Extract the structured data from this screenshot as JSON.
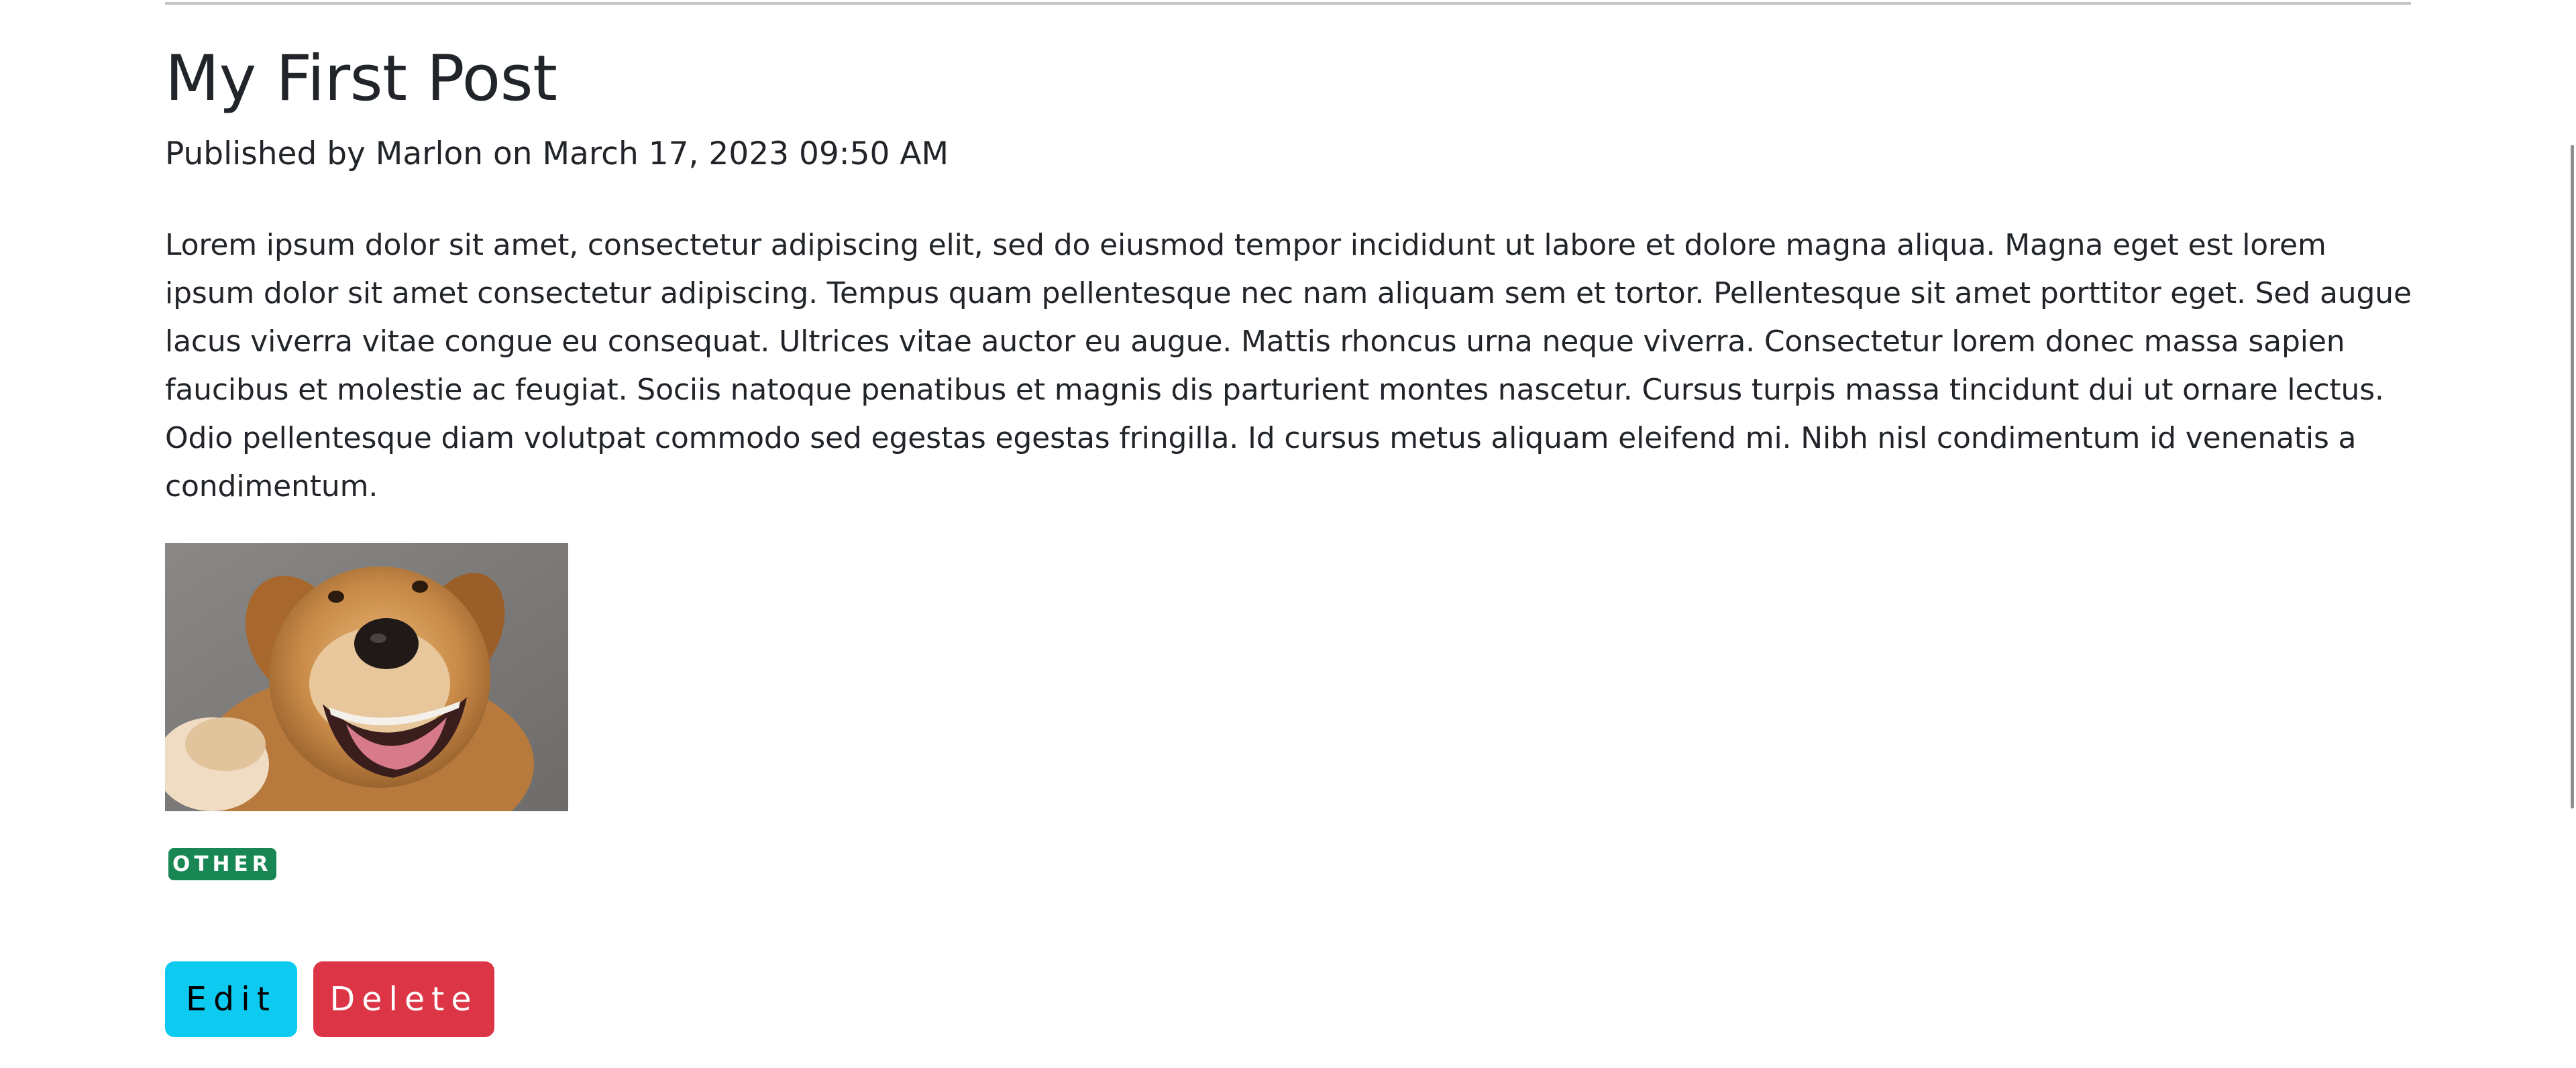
{
  "post": {
    "title": "My First Post",
    "meta": "Published by Marlon on March 17, 2023 09:50 AM",
    "body": "Lorem ipsum dolor sit amet, consectetur adipiscing elit, sed do eiusmod tempor incididunt ut labore et dolore magna aliqua. Magna eget est lorem ipsum dolor sit amet consectetur adipiscing. Tempus quam pellentesque nec nam aliquam sem et tortor. Pellentesque sit amet porttitor eget. Sed augue lacus viverra vitae congue eu consequat. Ultrices vitae auctor eu augue. Mattis rhoncus urna neque viverra. Consectetur lorem donec massa sapien faucibus et molestie ac feugiat. Sociis natoque penatibus et magnis dis parturient montes nascetur. Cursus turpis massa tincidunt dui ut ornare lectus. Odio pellentesque diam volutpat commodo sed egestas egestas fringilla. Id cursus metus aliquam eleifend mi. Nibh nisl condimentum id venenatis a condimentum.",
    "tag": "OTHER"
  },
  "actions": {
    "edit_label": "Edit",
    "delete_label": "Delete"
  },
  "colors": {
    "tag_badge": "#198754",
    "edit_button": "#0dcaf0",
    "delete_button": "#dc3545"
  }
}
